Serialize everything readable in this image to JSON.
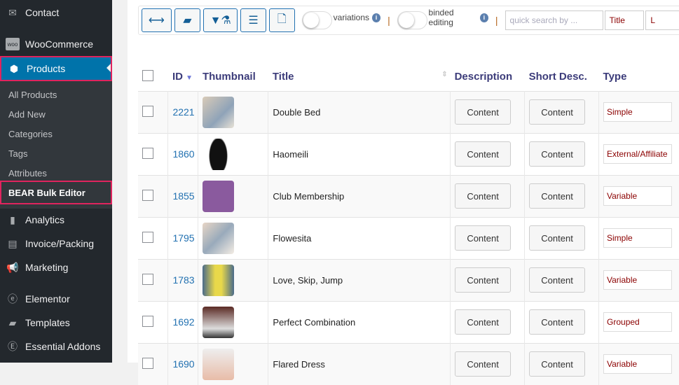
{
  "sidebar": {
    "items": [
      {
        "label": "Contact",
        "icon": "envelope-icon"
      },
      {
        "label": "WooCommerce",
        "icon": "woo-icon"
      },
      {
        "label": "Products",
        "icon": "box-icon",
        "active": true
      },
      {
        "label": "Analytics",
        "icon": "bar-chart-icon"
      },
      {
        "label": "Invoice/Packing",
        "icon": "document-icon"
      },
      {
        "label": "Marketing",
        "icon": "megaphone-icon"
      },
      {
        "label": "Elementor",
        "icon": "elementor-icon"
      },
      {
        "label": "Templates",
        "icon": "folder-icon"
      },
      {
        "label": "Essential Addons",
        "icon": "ea-icon"
      }
    ],
    "submenu": [
      "All Products",
      "Add New",
      "Categories",
      "Tags",
      "Attributes",
      "BEAR Bulk Editor"
    ]
  },
  "toolbar": {
    "variations_label": "variations",
    "binded_label": "binded editing",
    "search_placeholder": "quick search by ...",
    "search_field": "Title",
    "extra": "L"
  },
  "table": {
    "headers": [
      "ID",
      "Thumbnail",
      "Title",
      "Description",
      "Short Desc.",
      "Type"
    ],
    "rows": [
      {
        "id": "2221",
        "title": "Double Bed",
        "desc": "Content",
        "short": "Content",
        "type": "Simple"
      },
      {
        "id": "1860",
        "title": "Haomeili",
        "desc": "Content",
        "short": "Content",
        "type": "External/Affiliate"
      },
      {
        "id": "1855",
        "title": "Club Membership",
        "desc": "Content",
        "short": "Content",
        "type": "Variable"
      },
      {
        "id": "1795",
        "title": "Flowesita",
        "desc": "Content",
        "short": "Content",
        "type": "Simple"
      },
      {
        "id": "1783",
        "title": "Love, Skip, Jump",
        "desc": "Content",
        "short": "Content",
        "type": "Variable"
      },
      {
        "id": "1692",
        "title": "Perfect Combination",
        "desc": "Content",
        "short": "Content",
        "type": "Grouped"
      },
      {
        "id": "1690",
        "title": "Flared Dress",
        "desc": "Content",
        "short": "Content",
        "type": "Variable"
      }
    ]
  },
  "colors": {
    "sidebar": "#23282d",
    "active": "#0073aa",
    "highlight": "#e0245e",
    "header_text": "#3c3c7a"
  }
}
